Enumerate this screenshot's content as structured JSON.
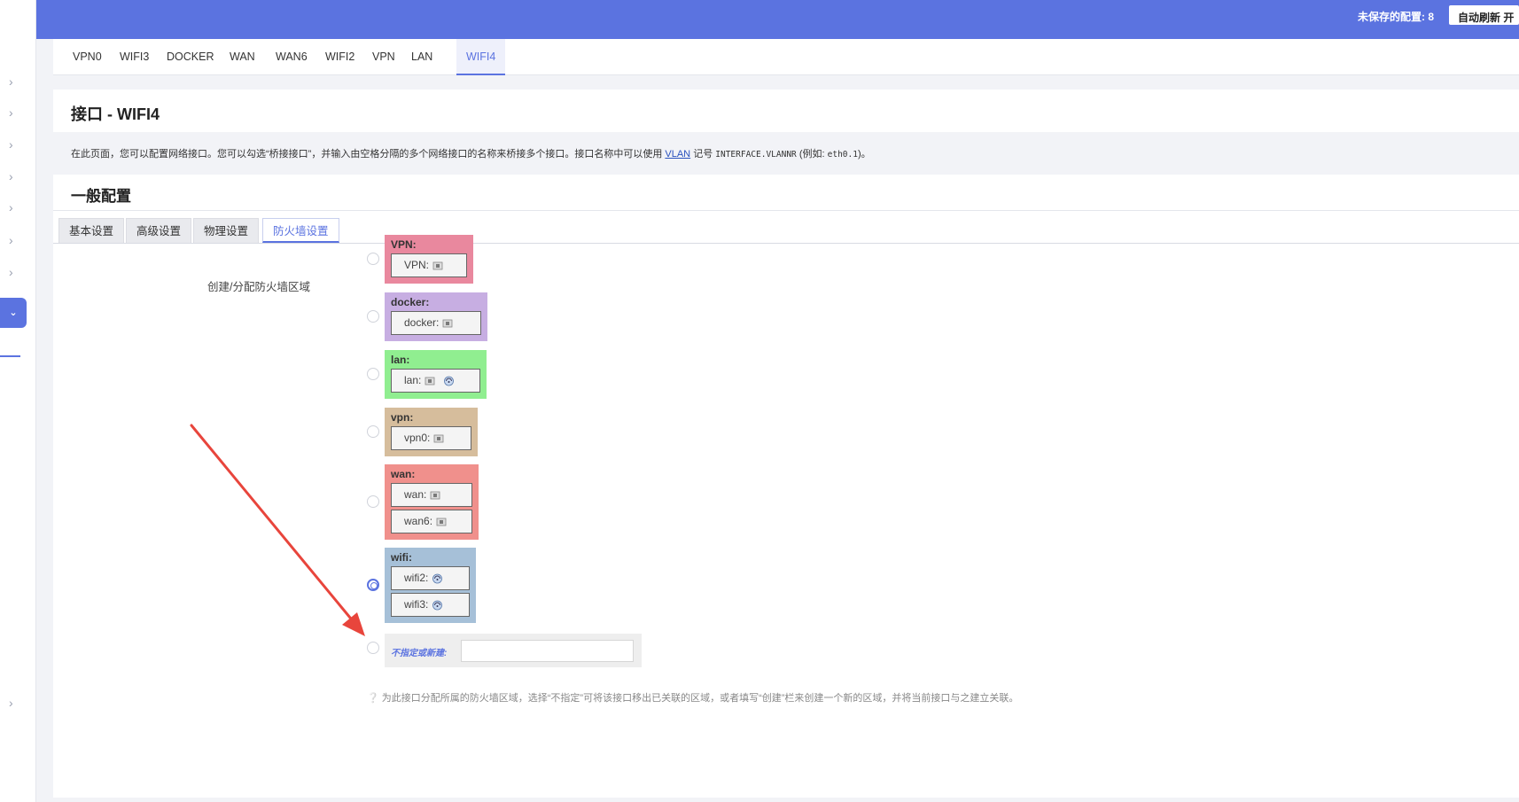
{
  "header": {
    "unsaved": "未保存的配置: 8",
    "autorefresh": "自动刷新 开"
  },
  "tabs": [
    {
      "label": "VPN0"
    },
    {
      "label": "WIFI3"
    },
    {
      "label": "DOCKER"
    },
    {
      "label": "WAN"
    },
    {
      "label": "WAN6"
    },
    {
      "label": "WIFI2"
    },
    {
      "label": "VPN"
    },
    {
      "label": "LAN"
    },
    {
      "label": "WIFI4",
      "active": true
    }
  ],
  "page": {
    "title": "接口 - WIFI4",
    "desc_pre": "在此页面，您可以配置网络接口。您可以勾选“桥接接口”，并输入由空格分隔的多个网络接口的名称来桥接多个接口。接口名称中可以使用 ",
    "desc_vlan": "VLAN",
    "desc_mid": " 记号 ",
    "desc_code": "INTERFACE.VLANNR",
    "desc_post": " (例如: ",
    "desc_example": "eth0.1",
    "desc_end": ")。"
  },
  "section": {
    "title": "一般配置",
    "subtabs": [
      "基本设置",
      "高级设置",
      "物理设置",
      "防火墙设置"
    ],
    "active_subtab": "防火墙设置",
    "field_label": "创建/分配防火墙区域"
  },
  "zones": [
    {
      "name": "VPN:",
      "color": "#e9889e",
      "interfaces": [
        {
          "label": "VPN:",
          "icons": [
            "ethernet-icon"
          ]
        }
      ]
    },
    {
      "name": "docker:",
      "color": "#c7aee2",
      "interfaces": [
        {
          "label": "docker:",
          "icons": [
            "ethernet-icon"
          ]
        }
      ]
    },
    {
      "name": "lan:",
      "color": "#90ee90",
      "interfaces": [
        {
          "label": "lan:",
          "icons": [
            "ethernet-icon",
            "wifi-icon"
          ]
        }
      ]
    },
    {
      "name": "vpn:",
      "color": "#d6bd9c",
      "interfaces": [
        {
          "label": "vpn0:",
          "icons": [
            "ethernet-icon"
          ]
        }
      ]
    },
    {
      "name": "wan:",
      "color": "#f0908c",
      "interfaces": [
        {
          "label": "wan:",
          "icons": [
            "ethernet-icon"
          ]
        },
        {
          "label": "wan6:",
          "icons": [
            "ethernet-icon"
          ]
        }
      ]
    },
    {
      "name": "wifi:",
      "color": "#a6c0d8",
      "selected": true,
      "interfaces": [
        {
          "label": "wifi2:",
          "icons": [
            "wifi-icon"
          ]
        },
        {
          "label": "wifi3:",
          "icons": [
            "wifi-icon"
          ]
        }
      ]
    }
  ],
  "new_zone": {
    "label": "不指定或新建:",
    "value": ""
  },
  "help": "为此接口分配所属的防火墙区域，选择“不指定”可将该接口移出已关联的区域，或者填写“创建”栏来创建一个新的区域，并将当前接口与之建立关联。",
  "colors": {
    "accent": "#5b73e0",
    "arrow": "#e8453c"
  }
}
